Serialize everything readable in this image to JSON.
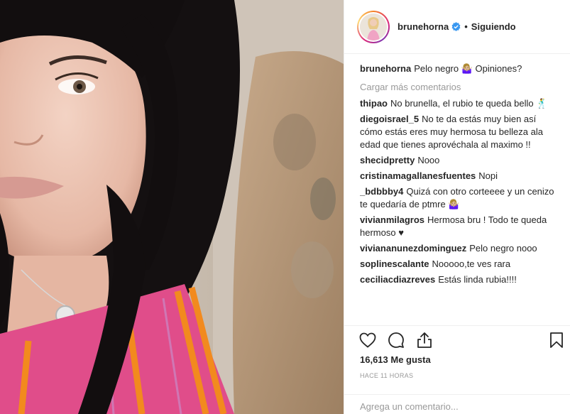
{
  "post": {
    "username": "brunehorna",
    "follow_status": "Siguiendo",
    "separator": "•",
    "caption": "Pelo negro 🤷🏼‍♀️ Opiniones?",
    "load_more": "Cargar más comentarios",
    "likes": "16,613 Me gusta",
    "time": "HACE 11 HORAS",
    "add_comment_placeholder": "Agrega un comentario..."
  },
  "comments": [
    {
      "user": "thipao",
      "text": "No brunella, el rubio te queda bello 🕺"
    },
    {
      "user": "diegoisrael_5",
      "text": "No te da estás muy bien así cómo estás eres muy hermosa tu belleza ala edad que tienes aprovéchala al maximo !!"
    },
    {
      "user": "shecidpretty",
      "text": "Nooo"
    },
    {
      "user": "cristinamagallanesfuentes",
      "text": "Nopi"
    },
    {
      "user": "_bdbbby4",
      "text": "Quizá con otro corteeee y un cenizo te quedaría de ptmre 🤷🏼‍♀️"
    },
    {
      "user": "vivianmilagros",
      "text": "Hermosa bru ! Todo te queda hermoso ♥"
    },
    {
      "user": "viviananunezdominguez",
      "text": "Pelo negro nooo"
    },
    {
      "user": "soplinescalante",
      "text": "Nooooo,te ves rara"
    },
    {
      "user": "ceciliacdiazreves",
      "text": "Estás linda rubia!!!!"
    }
  ],
  "icons": {
    "like": "heart-icon",
    "comment": "comment-icon",
    "share": "share-icon",
    "save": "bookmark-icon",
    "verified": "verified-badge-icon"
  },
  "colors": {
    "verified": "#3897f0",
    "muted": "#999999",
    "text": "#262626",
    "border": "#efefef"
  }
}
